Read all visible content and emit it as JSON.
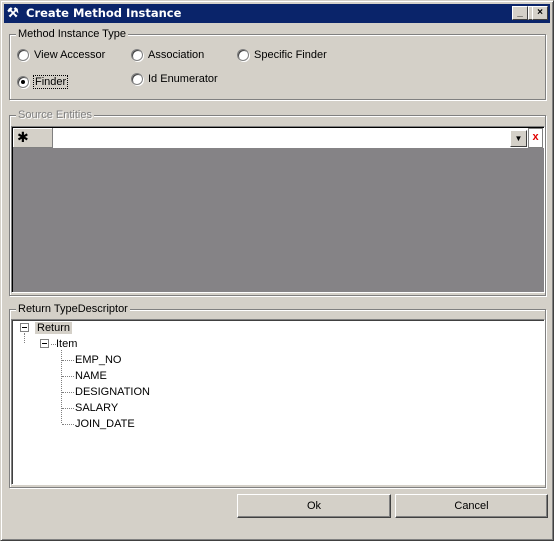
{
  "window": {
    "title": "Create Method Instance",
    "icon": "tools-icon",
    "controls": {
      "minimize": "_",
      "maximize": "□",
      "close": "×"
    }
  },
  "method_instance_type": {
    "label": "Method Instance Type",
    "options": [
      {
        "label": "View Accessor",
        "checked": false
      },
      {
        "label": "Association",
        "checked": false
      },
      {
        "label": "Specific Finder",
        "checked": false
      },
      {
        "label": "Finder",
        "checked": true
      },
      {
        "label": "Id Enumerator",
        "checked": false
      }
    ]
  },
  "source_entities": {
    "label": "Source Entities",
    "new_row_marker": "✱",
    "dropdown_value": "",
    "dropdown_icon": "▼",
    "delete_icon": "x"
  },
  "return_type_descriptor": {
    "label": "Return TypeDescriptor",
    "tree": {
      "root": "Return",
      "child": "Item",
      "fields": [
        "EMP_NO",
        "NAME",
        "DESIGNATION",
        "SALARY",
        "JOIN_DATE"
      ]
    }
  },
  "buttons": {
    "ok": "Ok",
    "cancel": "Cancel"
  }
}
